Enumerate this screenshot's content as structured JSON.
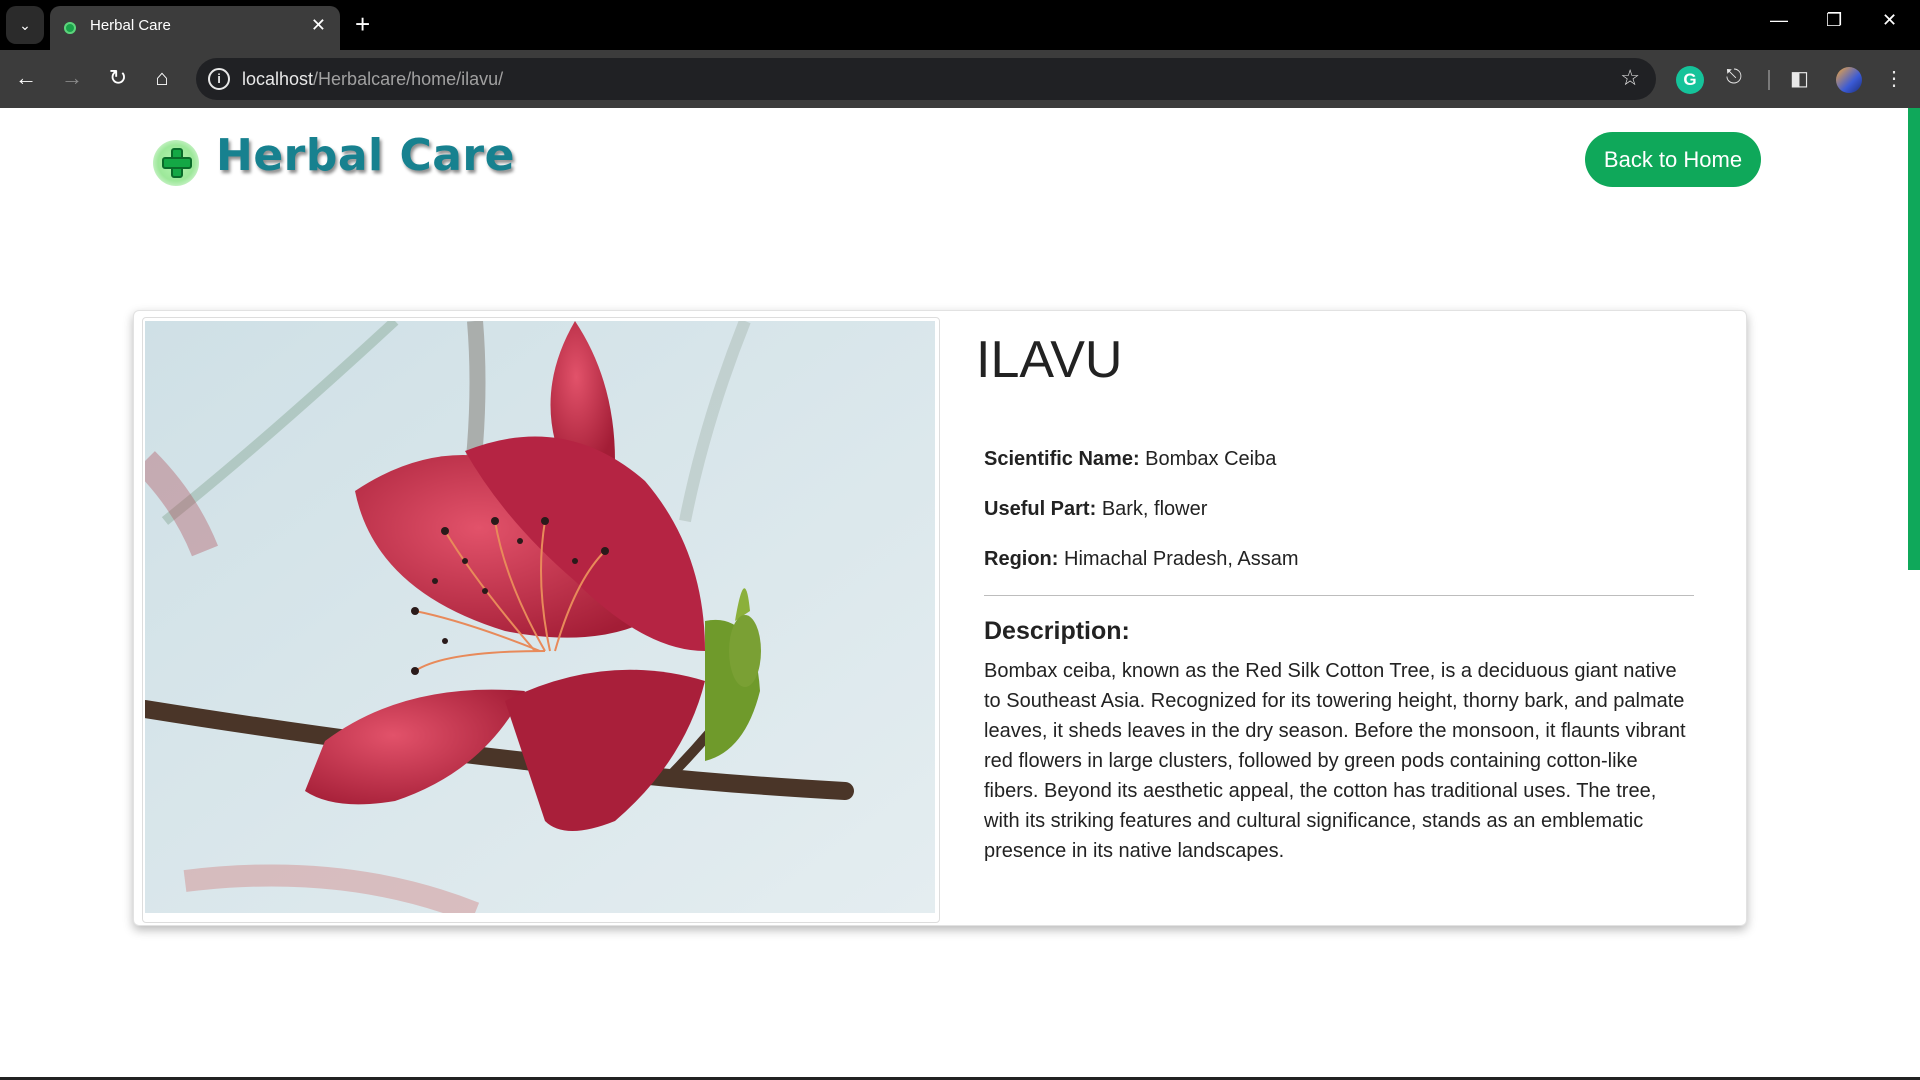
{
  "browser": {
    "tab_title": "Herbal Care",
    "url_host": "localhost",
    "url_path": "/Herbalcare/home/ilavu/"
  },
  "header": {
    "brand": "Herbal Care",
    "back_button": "Back to Home"
  },
  "herb": {
    "name": "ILAVU",
    "scientific_label": "Scientific Name:",
    "scientific_value": "Bombax Ceiba",
    "useful_label": "Useful Part:",
    "useful_value": "Bark, flower",
    "region_label": "Region:",
    "region_value": "Himachal Pradesh, Assam",
    "description_heading": "Description:",
    "description": "Bombax ceiba, known as the Red Silk Cotton Tree, is a deciduous giant native to Southeast Asia. Recognized for its towering height, thorny bark, and palmate leaves, it sheds leaves in the dry season. Before the monsoon, it flaunts vibrant red flowers in large clusters, followed by green pods containing cotton-like fibers. Beyond its aesthetic appeal, the cotton has traditional uses. The tree, with its striking features and cultural significance, stands as an emblematic presence in its native landscapes."
  },
  "colors": {
    "accent": "#0fa85a",
    "brand_text": "#17818f"
  }
}
